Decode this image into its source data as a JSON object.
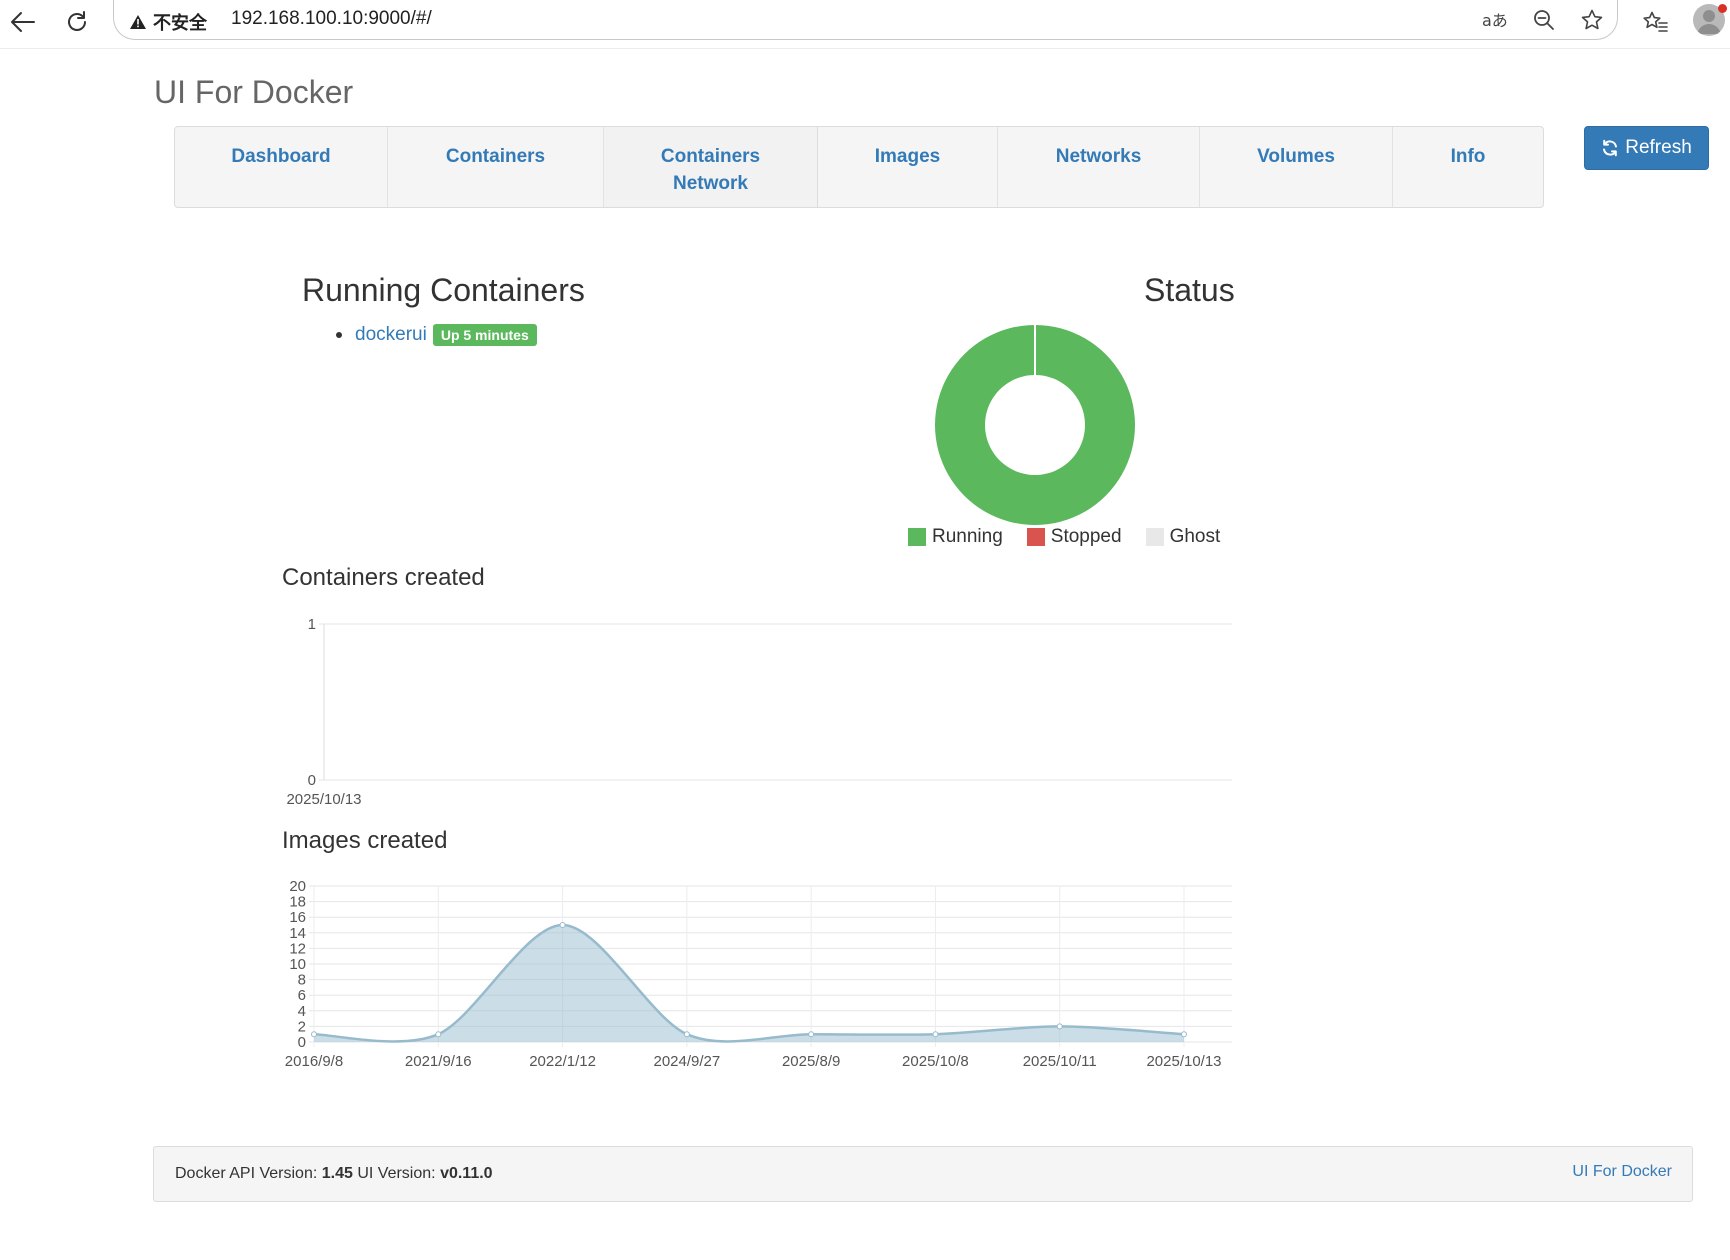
{
  "browser": {
    "security_label": "不安全",
    "url": "192.168.100.10:9000/#/"
  },
  "app": {
    "title": "UI For Docker"
  },
  "nav": {
    "items": [
      {
        "label": "Dashboard"
      },
      {
        "label": "Containers"
      },
      {
        "label": "Containers\nNetwork"
      },
      {
        "label": "Images"
      },
      {
        "label": "Networks"
      },
      {
        "label": "Volumes"
      },
      {
        "label": "Info"
      }
    ],
    "refresh_label": "Refresh"
  },
  "running": {
    "heading": "Running Containers",
    "containers": [
      {
        "name": "dockerui",
        "status": "Up 5 minutes"
      }
    ]
  },
  "status": {
    "heading": "Status",
    "legend": [
      {
        "label": "Running",
        "color": "#5cb85c"
      },
      {
        "label": "Stopped",
        "color": "#d9534f"
      },
      {
        "label": "Ghost",
        "color": "#e8e8e8"
      }
    ]
  },
  "charts": {
    "containers_heading": "Containers created",
    "images_heading": "Images created"
  },
  "chart_data": [
    {
      "type": "pie",
      "title": "Status",
      "categories": [
        "Running",
        "Stopped",
        "Ghost"
      ],
      "values": [
        1,
        0,
        0
      ],
      "colors": [
        "#5cb85c",
        "#d9534f",
        "#e8e8e8"
      ]
    },
    {
      "type": "line",
      "title": "Containers created",
      "x": [
        "2025/10/13"
      ],
      "series": [
        {
          "values": [
            0
          ]
        }
      ],
      "yticks": [
        "0",
        "1"
      ],
      "ylim": [
        0,
        1
      ],
      "grid": true
    },
    {
      "type": "area",
      "title": "Images created",
      "x": [
        "2016/9/8",
        "2021/9/16",
        "2022/1/12",
        "2024/9/27",
        "2025/8/9",
        "2025/10/8",
        "2025/10/11",
        "2025/10/13"
      ],
      "series": [
        {
          "values": [
            1,
            1,
            15,
            1,
            1,
            1,
            2,
            1
          ],
          "color": "#97bbcd"
        }
      ],
      "yticks": [
        "0",
        "2",
        "4",
        "6",
        "8",
        "10",
        "12",
        "14",
        "16",
        "18",
        "20"
      ],
      "ylim": [
        0,
        20
      ],
      "grid": true
    }
  ],
  "footer": {
    "api_label": "Docker API Version:",
    "api_version": "1.45",
    "ui_label": "UI Version:",
    "ui_version": "v0.11.0",
    "link": "UI For Docker"
  }
}
